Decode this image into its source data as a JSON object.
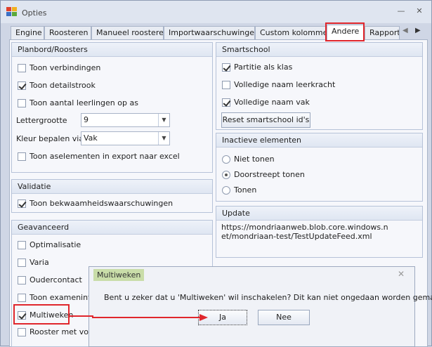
{
  "window": {
    "title": "Opties"
  },
  "tabs": [
    {
      "label": "Engine"
    },
    {
      "label": "Roosteren"
    },
    {
      "label": "Manueel roosteren"
    },
    {
      "label": "Importwaarschuwingen"
    },
    {
      "label": "Custom kolommen"
    },
    {
      "label": "Andere",
      "active": true
    },
    {
      "label": "Rapportla"
    }
  ],
  "planbord": {
    "header": "Planbord/Roosters",
    "toon_verbindingen": "Toon verbindingen",
    "toon_detailstrook": "Toon detailstrook",
    "toon_aantal": "Toon aantal leerlingen op as",
    "lettergrootte_label": "Lettergrootte",
    "lettergrootte_value": "9",
    "kleur_label": "Kleur bepalen via",
    "kleur_value": "Vak",
    "toon_aselementen": "Toon aselementen in export naar excel"
  },
  "validatie": {
    "header": "Validatie",
    "toon_bekwaamheid": "Toon bekwaamheidswaarschuwingen"
  },
  "geavanceerd": {
    "header": "Geavanceerd",
    "optimalisatie": "Optimalisatie",
    "varia": "Varia",
    "oudercontact": "Oudercontact",
    "toon_exameninfo": "Toon exameninfo",
    "multiweken": "Multiweken",
    "rooster_volled": "Rooster met volled"
  },
  "smartschool": {
    "header": "Smartschool",
    "partitie": "Partitie als klas",
    "volledige_leerkracht": "Volledige naam leerkracht",
    "volledige_vak": "Volledige naam vak",
    "reset_button": "Reset smartschool id's"
  },
  "inactieve": {
    "header": "Inactieve elementen",
    "niet_tonen": "Niet tonen",
    "doorstreept": "Doorstreept tonen",
    "tonen": "Tonen"
  },
  "update": {
    "header": "Update",
    "url": "https://mondriaanweb.blob.core.windows.net/mondriaan-test/TestUpdateFeed.xml"
  },
  "dialog": {
    "title": "Multiweken",
    "message": "Bent u zeker dat u 'Multiweken' wil inschakelen? Dit kan niet ongedaan worden gemaakt.",
    "yes_label": "Ja",
    "no_label": "Nee"
  },
  "colors": {
    "highlight": "#e0262c",
    "dialog_title_bg": "#c9dda9",
    "window_bg": "#cfd6e5"
  }
}
